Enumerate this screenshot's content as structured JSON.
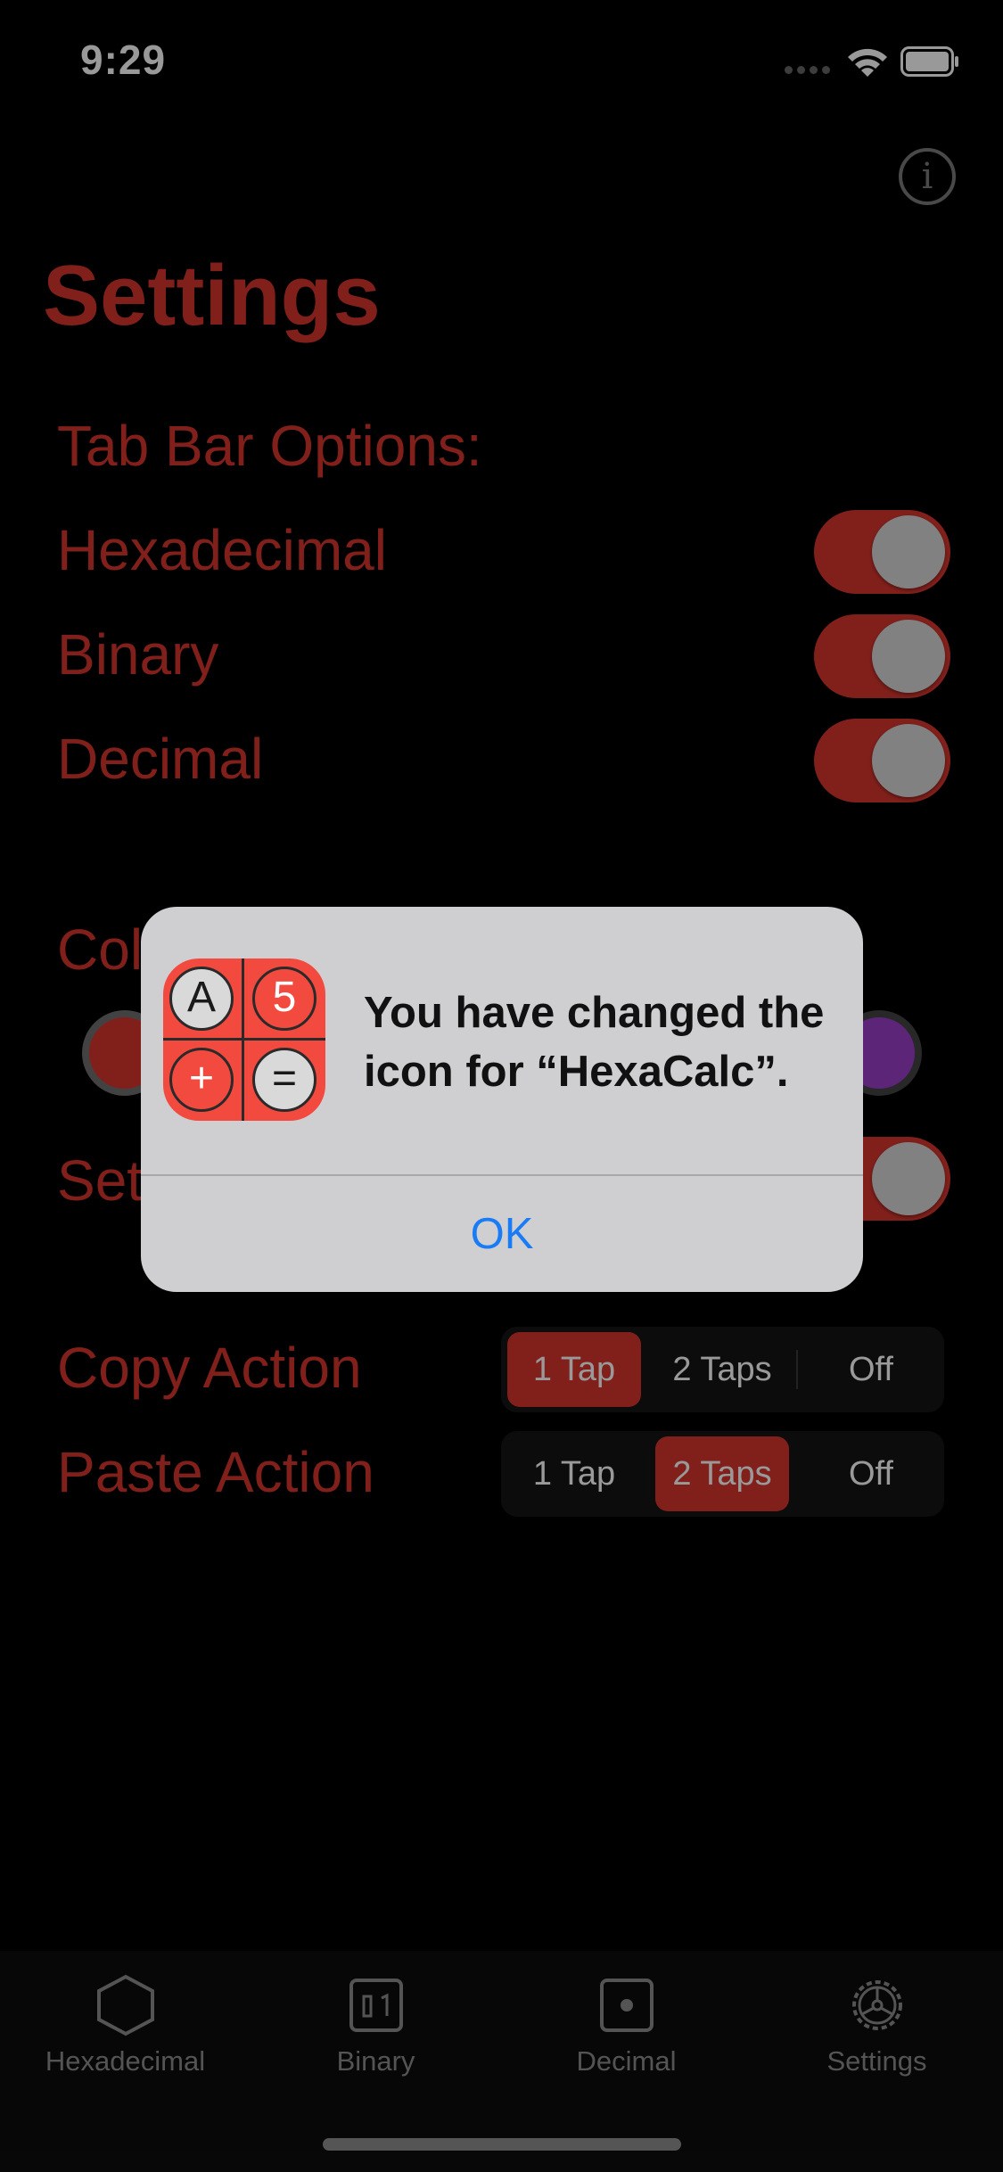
{
  "status_bar": {
    "time": "9:29"
  },
  "header": {
    "title": "Settings",
    "info_icon": "info-circle-icon"
  },
  "tab_bar_options": {
    "label": "Tab Bar Options:",
    "rows": [
      {
        "label": "Hexadecimal",
        "on": true
      },
      {
        "label": "Binary",
        "on": true
      },
      {
        "label": "Decimal",
        "on": true
      }
    ]
  },
  "partially_hidden": {
    "color_label": "Col",
    "setting_label": "Set"
  },
  "copy_action": {
    "label": "Copy Action",
    "options": [
      "1 Tap",
      "2 Taps",
      "Off"
    ],
    "selected": "1 Tap"
  },
  "paste_action": {
    "label": "Paste Action",
    "options": [
      "1 Tap",
      "2 Taps",
      "Off"
    ],
    "selected": "2 Taps"
  },
  "alert": {
    "message": "You have changed the icon for “HexaCalc”.",
    "ok_label": "OK",
    "icon_keys": [
      "A",
      "5",
      "+",
      "="
    ]
  },
  "tabs": [
    {
      "label": "Hexadecimal",
      "icon": "hexagon-icon"
    },
    {
      "label": "Binary",
      "icon": "binary-icon"
    },
    {
      "label": "Decimal",
      "icon": "decimal-icon"
    },
    {
      "label": "Settings",
      "icon": "gear-icon"
    }
  ],
  "colors": {
    "accent": "#d8362e",
    "swatch_red": "#d8362e",
    "swatch_purple": "#9b3fc9",
    "link_blue": "#1a7cf5"
  }
}
